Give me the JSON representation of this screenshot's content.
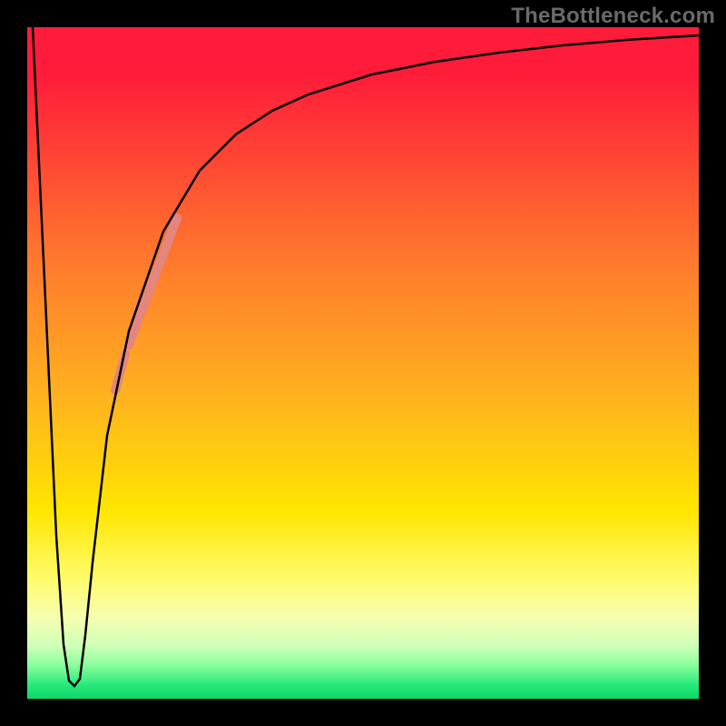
{
  "watermark": "TheBottleneck.com",
  "colors": {
    "frame_bg": "#000000",
    "curve": "#000000",
    "highlight": "#e4857e",
    "gradient_top": "#ff1c3a",
    "gradient_bottom": "#0fd66a",
    "watermark": "#6a6a6a"
  },
  "chart_data": {
    "type": "line",
    "title": "",
    "xlabel": "",
    "ylabel": "",
    "xlim": [
      0,
      100
    ],
    "ylim": [
      0,
      100
    ],
    "grid": false,
    "legend": false,
    "note": "No numeric axis ticks are rendered in the image; x and y units are unlabeled. Values below are read off the curve shape relative to a 0–100 box where y increases upward (0 = bottom/green, 100 = top/red).",
    "series": [
      {
        "name": "bottleneck-curve",
        "x": [
          0,
          2,
          4,
          5,
          6,
          7,
          8,
          9,
          10,
          12,
          15,
          20,
          25,
          30,
          35,
          40,
          50,
          60,
          70,
          80,
          90,
          100
        ],
        "y": [
          100,
          60,
          25,
          8,
          3,
          2,
          3,
          10,
          22,
          40,
          55,
          70,
          79,
          84,
          88,
          90,
          93,
          95,
          96.5,
          97.5,
          98.2,
          98.8
        ]
      }
    ],
    "highlight_segments": [
      {
        "name": "upper",
        "x_range": [
          14,
          22
        ],
        "y_range": [
          53,
          72
        ]
      },
      {
        "name": "lower",
        "x_range": [
          12,
          14
        ],
        "y_range": [
          45,
          53
        ]
      }
    ],
    "background_gradient": {
      "orientation": "vertical",
      "stops": [
        {
          "pos": 0.0,
          "color": "#ff1c3a"
        },
        {
          "pos": 0.35,
          "color": "#ff7a2d"
        },
        {
          "pos": 0.72,
          "color": "#ffe600"
        },
        {
          "pos": 0.92,
          "color": "#d0ffb8"
        },
        {
          "pos": 1.0,
          "color": "#0fd66a"
        }
      ]
    }
  }
}
